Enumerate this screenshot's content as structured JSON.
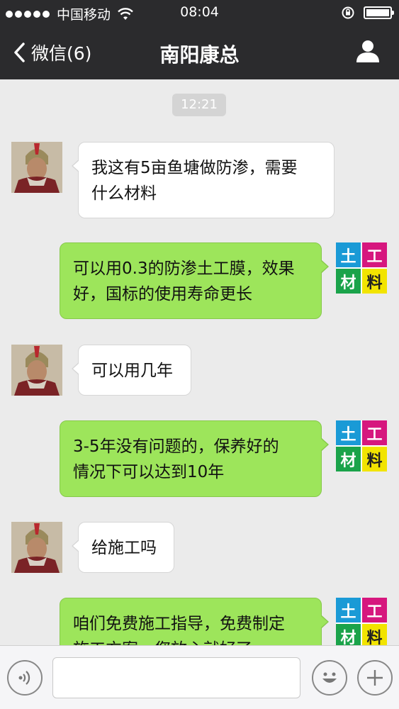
{
  "status_bar": {
    "carrier": "中国移动",
    "time": "08:04"
  },
  "nav": {
    "back_label": "微信(6)",
    "title": "南阳康总"
  },
  "chat": {
    "timestamp": "12:21",
    "messages": [
      {
        "from": "contact",
        "text_lines": [
          "我这有5亩鱼塘做防渗，需要",
          "什么材料"
        ]
      },
      {
        "from": "me",
        "text_lines": [
          "可以用0.3的防渗土工膜，效果",
          "好，国标的使用寿命更长"
        ]
      },
      {
        "from": "contact",
        "text_lines": [
          "可以用几年"
        ]
      },
      {
        "from": "me",
        "text_lines": [
          "3-5年没有问题的，保养好的",
          "情况下可以达到10年"
        ]
      },
      {
        "from": "contact",
        "text_lines": [
          "给施工吗"
        ]
      },
      {
        "from": "me",
        "text_lines": [
          "咱们免费施工指导，免费制定",
          "施工方案，您放心就好了"
        ]
      }
    ],
    "logo_chars": [
      "土",
      "工",
      "材",
      "料"
    ]
  },
  "colors": {
    "header_bg": "#2b2b2d",
    "chat_bg": "#ebebeb",
    "incoming_bubble": "#ffffff",
    "outgoing_bubble": "#9de55b"
  }
}
